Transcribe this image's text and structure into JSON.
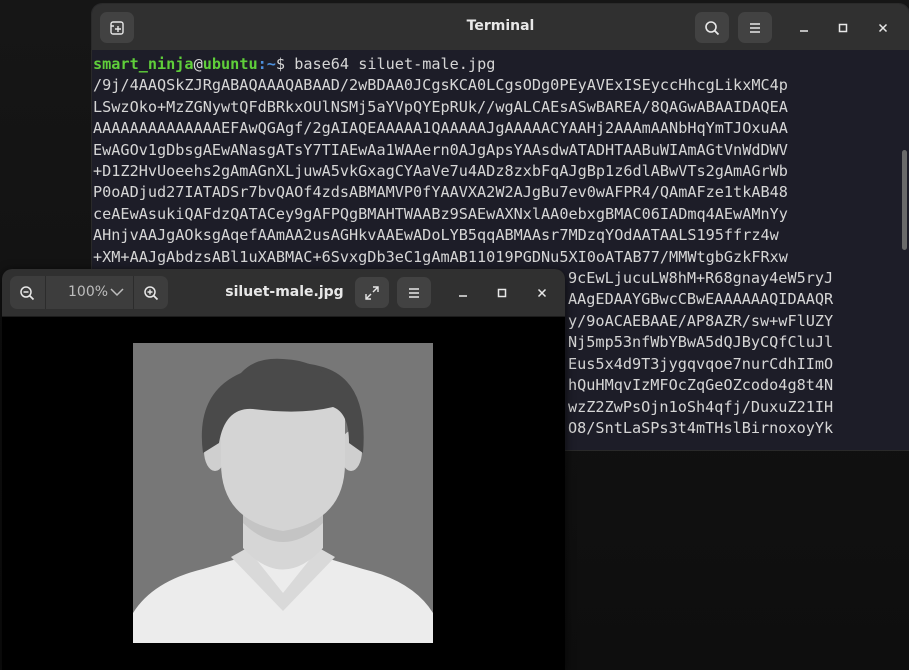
{
  "terminal": {
    "title": "Terminal",
    "prompt": {
      "user": "smart_ninja",
      "at": "@",
      "host": "ubuntu",
      "path": ":~",
      "symbol": "$ "
    },
    "command": "base64 siluet-male.jpg",
    "output_lines": [
      "/9j/4AAQSkZJRgABAQAAAQABAAD/2wBDAA0JCgsKCA0LCgsODg0PEyAVExISEyccHhcgLikxMC4p",
      "LSwzOko+MzZGNywtQFdBRkxOUlNSMj5aYVpQYEpRUk//wgALCAEsASwBAREA/8QAGwABAAIDAQEA",
      "AAAAAAAAAAAAAAEFAwQGAgf/2gAIAQEAAAAA1QAAAAAJgAAAAACYAAHj2AAAmAANbHqYmTJOxuAA",
      "EwAGOv1gDbsgAEwANasgATsY7TIAEwAa1WAAern0AJgApsYAAsdwATADHTAABuWIAmAGtVnWdDWV",
      "+D1Z2HvUoeehs2gAmAGnXLjuwA5vkGxagCYAaVe7u4ADz8zxbFqAJgBp1z6dlABwVTs2gAmAGrWb",
      "P0oADjud27IATADSr7bvQAOf4zdsABMAMVP0fYAAVXA2W2AJgBu7ev0wAFPR4/QAmAFze1tkAB48",
      "ceAEwAsukiQAFdzQATACey9gAFPQgBMAHTWAABz9SAEwAXNxlAA0ebxgBMAC06IADmq4AEwAMnYy",
      "AHnjvAAJgAOksgAqefAAmAA2usAGHkvAAEwADoLYB5qqABMAAsr7MDzqYOdAATAALS195ffrz4w",
      "+XM+AAJgAbdzsABl1uXABMAC+6SvxgDb3eC1gAmAB11019PGDNu5XI0oATAB77/MMWtgbGzkFRxw",
      "",
      "",
      "",
      "",
      "",
      "",
      ""
    ],
    "visible_right_fragments": [
      "9cEwLjucuLW8hM+R68gnay4eW5ryJ",
      "AAgEDAAYGBwcCBwEAAAAAAQIDAAQR",
      "y/9oACAEBAAE/AP8AZR/sw+wFlUZY",
      "Nj5mp53nfWbYBwA5dQJByCQfCluJl",
      "Eus5x4d9T3jygqvqoe7nurCdhIImO",
      "hQuHMqvIzMFOcZqGeOZcodo4g8t4N",
      "wzZ2ZwPsOjn1oSh4qfj/DuxuZ21IH",
      "O8/SntLaSPs3t4mTHslBirnoxoyYk"
    ]
  },
  "viewer": {
    "zoom": "100%",
    "title": "siluet-male.jpg",
    "image_alt": "Grey silhouette placeholder of a male person"
  }
}
